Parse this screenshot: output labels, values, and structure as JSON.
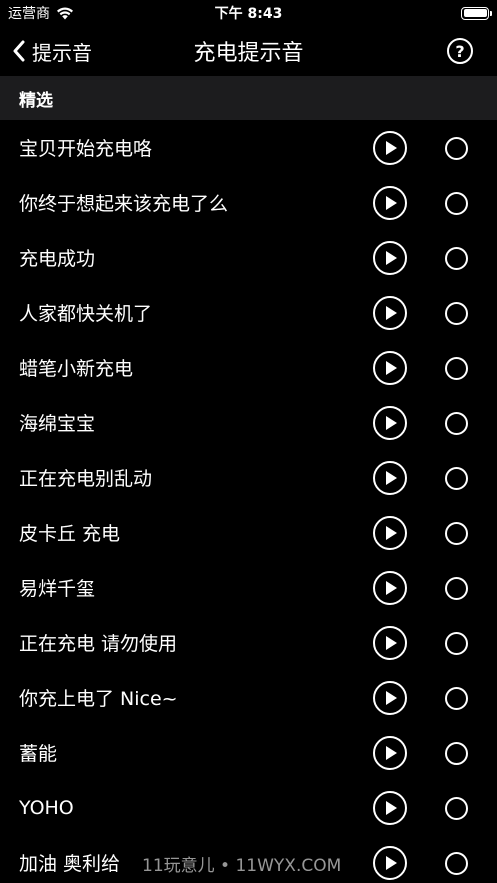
{
  "status_bar": {
    "carrier": "运营商",
    "time": "下午 8:43"
  },
  "nav": {
    "back_label": "提示音",
    "title": "充电提示音",
    "help_symbol": "?"
  },
  "section": {
    "title": "精选"
  },
  "items": [
    {
      "label": "宝贝开始充电咯"
    },
    {
      "label": "你终于想起来该充电了么"
    },
    {
      "label": "充电成功"
    },
    {
      "label": "人家都快关机了"
    },
    {
      "label": "蜡笔小新充电"
    },
    {
      "label": "海绵宝宝"
    },
    {
      "label": "正在充电别乱动"
    },
    {
      "label": "皮卡丘 充电"
    },
    {
      "label": "易烊千玺"
    },
    {
      "label": "正在充电 请勿使用"
    },
    {
      "label": "你充上电了 Nice~"
    },
    {
      "label": "蓄能"
    },
    {
      "label": "YOHO"
    },
    {
      "label": "加油 奥利给"
    }
  ],
  "watermark": "11玩意儿 • 11WYX.COM"
}
